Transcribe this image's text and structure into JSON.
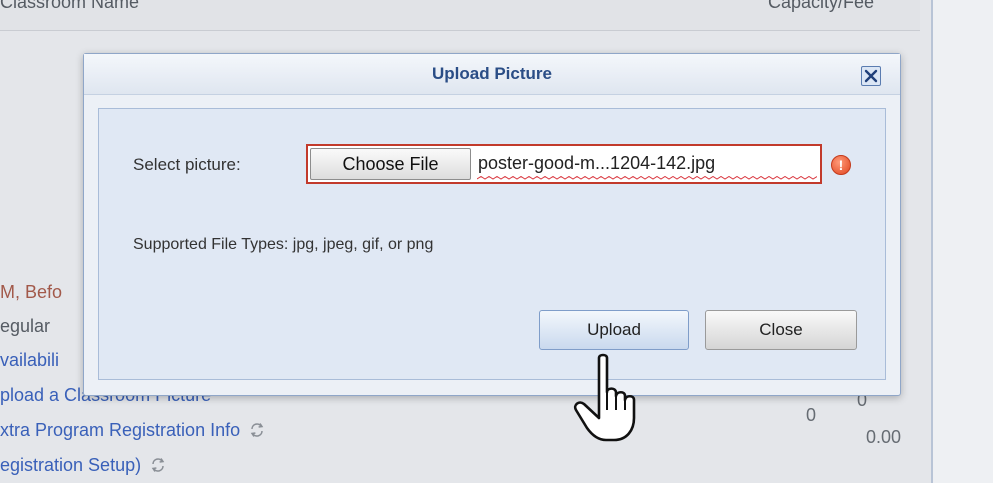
{
  "background": {
    "header": {
      "col_name": "Classroom Name",
      "col_capacity": "Capacity/Fee"
    },
    "rows": [
      {
        "text": "M, Befo",
        "color": "brown"
      },
      {
        "text": "egular",
        "color": "gray"
      },
      {
        "text": "vailabili",
        "color": "blue"
      },
      {
        "text": "pload a Classroom Picture",
        "color": "blue"
      },
      {
        "text": "xtra Program Registration Info",
        "color": "blue"
      },
      {
        "text": "egistration Setup)",
        "color": "blue"
      }
    ],
    "numbers": {
      "capacity": "0",
      "fee": "0.00",
      "partial": "0"
    },
    "icons": {
      "sync": "sync-icon"
    }
  },
  "dialog": {
    "title": "Upload Picture",
    "close_icon": "close-icon",
    "select_label": "Select picture:",
    "choose_file_label": "Choose File",
    "file_name": "poster-good-m...1204-142.jpg",
    "error_icon": "error-icon",
    "supported_text": "Supported File Types: jpg, jpeg, gif, or png",
    "upload_label": "Upload",
    "close_label": "Close"
  },
  "colors": {
    "title": "#2a4d86",
    "error_border": "#c23a2b",
    "link_blue": "#3960b9",
    "link_brown": "#a2594a"
  }
}
